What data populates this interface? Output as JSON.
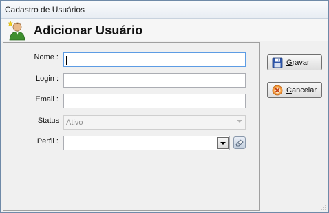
{
  "window": {
    "title": "Cadastro de Usuários"
  },
  "header": {
    "title": "Adicionar Usuário",
    "icon": "user-add-icon"
  },
  "form": {
    "nome_label": "Nome :",
    "nome_value": "",
    "login_label": "Login :",
    "login_value": "",
    "email_label": "Email :",
    "email_value": "",
    "status_label": "Status",
    "status_value": "Ativo",
    "perfil_label": "Perfil :",
    "perfil_value": ""
  },
  "buttons": {
    "gravar_label": "Gravar",
    "gravar_icon": "floppy-disk-icon",
    "cancelar_label": "Cancelar",
    "cancelar_icon": "cancel-circle-icon"
  },
  "colors": {
    "focus_border": "#5d9ce4",
    "title_text": "#1b1b1b"
  }
}
